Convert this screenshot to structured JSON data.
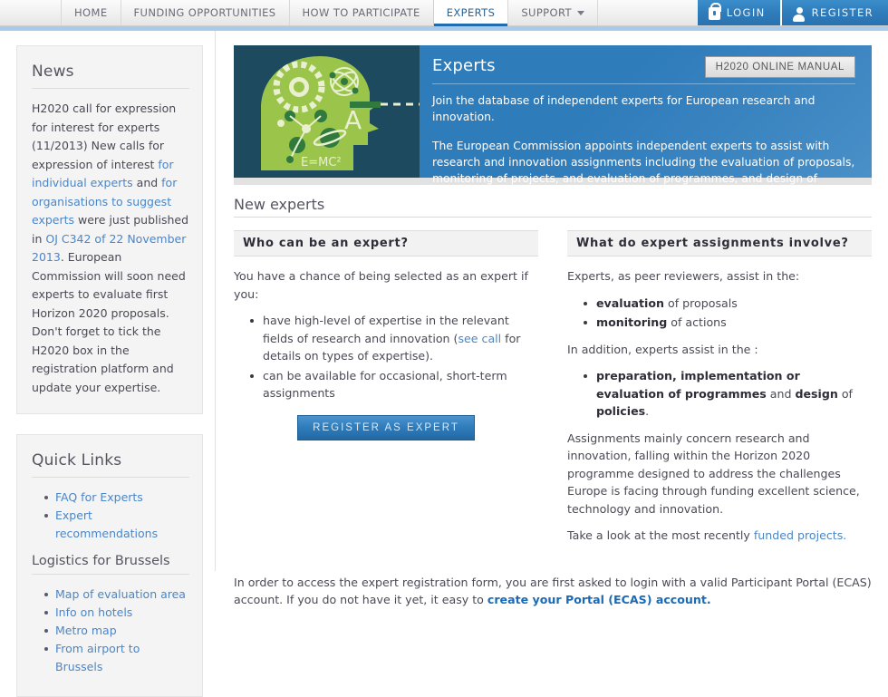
{
  "nav": {
    "items": [
      {
        "label": "HOME",
        "active": false,
        "caret": false
      },
      {
        "label": "FUNDING OPPORTUNITIES",
        "active": false,
        "caret": false
      },
      {
        "label": "HOW TO PARTICIPATE",
        "active": false,
        "caret": false
      },
      {
        "label": "EXPERTS",
        "active": true,
        "caret": false
      },
      {
        "label": "SUPPORT",
        "active": false,
        "caret": true
      }
    ],
    "login_label": "LOGIN",
    "register_label": "REGISTER",
    "accent_color": "#2f7cbb",
    "active_underline_color": "#1f6cb0"
  },
  "sidebar": {
    "news": {
      "title": "News",
      "segments": [
        {
          "text": "H2020 call for expression for interest for experts (11/2013) New calls for expression of interest ",
          "link": false
        },
        {
          "text": "for individual experts",
          "link": true
        },
        {
          "text": " and ",
          "link": false
        },
        {
          "text": "for organisations to suggest experts",
          "link": true
        },
        {
          "text": " were just published in ",
          "link": false
        },
        {
          "text": "OJ C342 of 22 November 2013",
          "link": true
        },
        {
          "text": ". European Commission will soon need experts to evaluate first Horizon 2020 proposals. Don't forget to tick the H2020 box in the registration platform and update your expertise.",
          "link": false
        }
      ]
    },
    "quick_links": {
      "title": "Quick Links",
      "items": [
        "FAQ for Experts",
        "Expert recommendations"
      ],
      "sub_title": "Logistics for Brussels",
      "sub_items": [
        "Map of evaluation area",
        "Info on hotels",
        "Metro map",
        "From airport to Brussels"
      ]
    }
  },
  "banner": {
    "title": "Experts",
    "manual_button": "H2020 ONLINE MANUAL",
    "paragraph1": "Join the database of independent experts for European research and innovation.",
    "paragraph2": "The European Commission appoints independent experts to assist with research and innovation assignments including the evaluation of proposals, monitoring of projects, and evaluation of programmes, and design of policy.",
    "image_alt": "green-head-science-illustration",
    "image_colors": {
      "background": "#1d4a5e",
      "head": "#9bc44a",
      "detail": "#e8f0cf",
      "dark_dot": "#2f7a3c"
    },
    "image_formula": "E=MC²",
    "image_letter": "A"
  },
  "main": {
    "section_title": "New experts",
    "left_column": {
      "heading": "Who can be an expert?",
      "intro": "You have a chance of being selected as an expert if you:",
      "bullets": [
        {
          "segments": [
            {
              "text": "have high-level of expertise in the relevant fields of research and innovation (",
              "style": "plain"
            },
            {
              "text": "see call",
              "style": "link"
            },
            {
              "text": " for details on types of expertise).",
              "style": "plain"
            }
          ]
        },
        {
          "segments": [
            {
              "text": "can be available for occasional, short-term assignments",
              "style": "plain"
            }
          ]
        }
      ],
      "register_button": "REGISTER AS EXPERT"
    },
    "right_column": {
      "heading": "What do expert assignments involve?",
      "intro1": "Experts, as peer reviewers, assist in the:",
      "bullets1": [
        {
          "segments": [
            {
              "text": "evaluation",
              "style": "bold"
            },
            {
              "text": " of proposals",
              "style": "plain"
            }
          ]
        },
        {
          "segments": [
            {
              "text": "monitoring",
              "style": "bold"
            },
            {
              "text": " of actions",
              "style": "plain"
            }
          ]
        }
      ],
      "intro2": "In addition, experts assist in the :",
      "bullets2": [
        {
          "segments": [
            {
              "text": "preparation, implementation or evaluation of programmes",
              "style": "bold"
            },
            {
              "text": " and ",
              "style": "plain"
            },
            {
              "text": "design",
              "style": "bold"
            },
            {
              "text": " of ",
              "style": "plain"
            },
            {
              "text": "policies",
              "style": "bold"
            },
            {
              "text": ".",
              "style": "plain"
            }
          ]
        }
      ],
      "paragraph": "Assignments mainly concern research and innovation, falling within the Horizon 2020 programme designed to address the challenges Europe is facing through funding excellent science, technology and innovation.",
      "closing_segments": [
        {
          "text": "Take a look at the most recently ",
          "style": "plain"
        },
        {
          "text": "funded projects.",
          "style": "link"
        }
      ]
    },
    "footer_segments": [
      {
        "text": "In order to access the expert registration form, you are first asked to login with a valid Participant Portal (ECAS) account. If you do not have it yet, it easy to ",
        "style": "plain"
      },
      {
        "text": "create your Portal (ECAS) account.",
        "style": "strong-link"
      }
    ]
  }
}
